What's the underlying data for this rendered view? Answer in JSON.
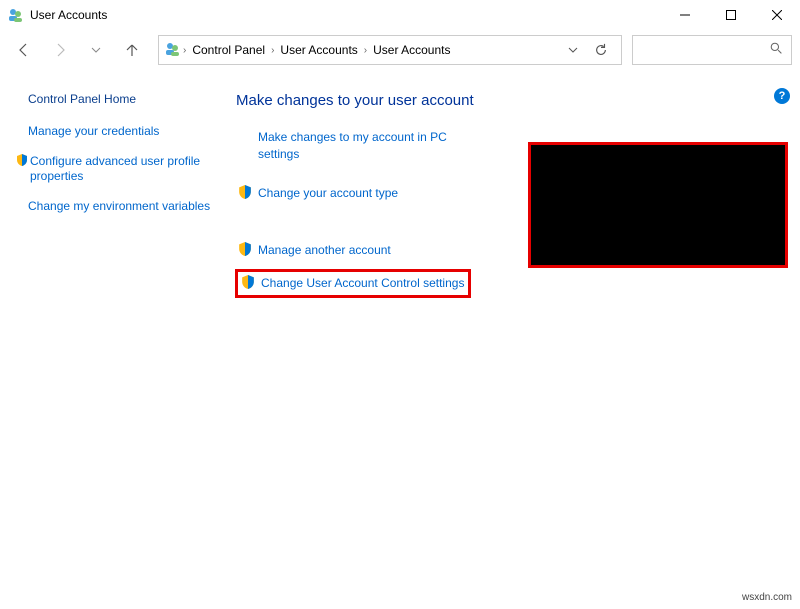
{
  "window": {
    "title": "User Accounts"
  },
  "breadcrumb": {
    "root": "Control Panel",
    "mid": "User Accounts",
    "leaf": "User Accounts"
  },
  "sidebar": {
    "heading": "Control Panel Home",
    "items": [
      {
        "label": "Manage your credentials"
      },
      {
        "label": "Configure advanced user profile properties"
      },
      {
        "label": "Change my environment variables"
      }
    ]
  },
  "main": {
    "heading": "Make changes to your user account",
    "actions": [
      {
        "label": "Make changes to my account in PC settings"
      },
      {
        "label": "Change your account type"
      },
      {
        "label": "Manage another account"
      },
      {
        "label": "Change User Account Control settings"
      }
    ]
  },
  "watermark": "wsxdn.com"
}
